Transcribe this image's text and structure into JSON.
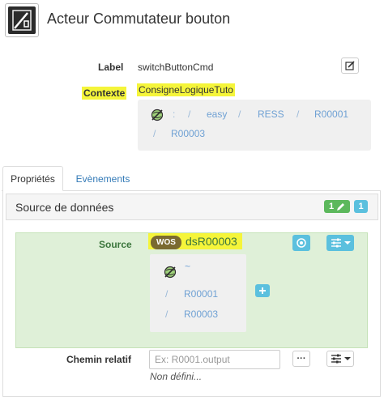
{
  "header": {
    "title": "Acteur Commutateur bouton",
    "icon": "switch-toggle-icon"
  },
  "fields": {
    "label": {
      "name": "Label",
      "value": "switchButtonCmd"
    },
    "contexte": {
      "name": "Contexte",
      "value": "ConsigneLogiqueTuto"
    }
  },
  "context_path": {
    "icon": "globe-icon",
    "colon": ":",
    "segments": [
      "easy",
      "RESS",
      "R00001",
      "R00003"
    ],
    "separator": "/"
  },
  "tabs": [
    {
      "label": "Propriétés",
      "active": true
    },
    {
      "label": "Evènements",
      "active": false
    }
  ],
  "panel": {
    "title": "Source de données",
    "badge_edit_count": "1",
    "badge_info_count": "1",
    "colors": {
      "badge_green": "#5cb85c",
      "badge_blue": "#5bc0de"
    }
  },
  "source": {
    "label": "Source",
    "type_badge": "WOS",
    "name": "dsR00003",
    "path": {
      "root": "~",
      "separator": "/",
      "segments": [
        "R00001",
        "R00003"
      ]
    }
  },
  "relative_path": {
    "label": "Chemin relatif",
    "placeholder": "Ex: R0001.output",
    "value": "",
    "status": "Non défini...",
    "more_button": "···"
  },
  "colors": {
    "highlight": "#f5f53a",
    "link": "#6fa1d4",
    "source_bg": "#dff0d8",
    "source_text": "#3c763d"
  }
}
